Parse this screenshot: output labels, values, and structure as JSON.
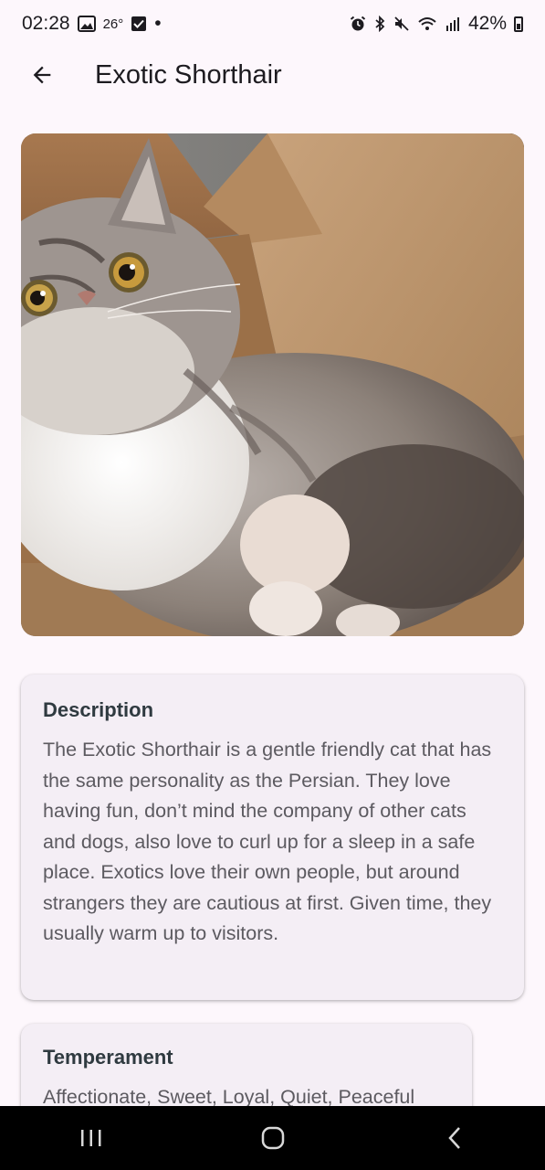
{
  "status_bar": {
    "time": "02:28",
    "temperature": "26°",
    "dot": "•",
    "battery": "42%"
  },
  "app_bar": {
    "title": "Exotic Shorthair",
    "back_icon": "arrow-back-icon"
  },
  "description_card": {
    "title": "Description",
    "body": "The Exotic Shorthair is a gentle friendly cat that has the same personality as the Persian. They love having fun, don’t mind the company of other cats and dogs, also love to curl up for a sleep in a safe place. Exotics love their own people, but around strangers they are cautious at first. Given time, they usually warm up to visitors."
  },
  "temperament_card": {
    "title": "Temperament",
    "body": "Affectionate, Sweet, Loyal, Quiet, Peaceful"
  },
  "nav_bar": {
    "recents_icon": "recents-icon",
    "home_icon": "home-icon",
    "back_icon": "nav-back-icon"
  }
}
